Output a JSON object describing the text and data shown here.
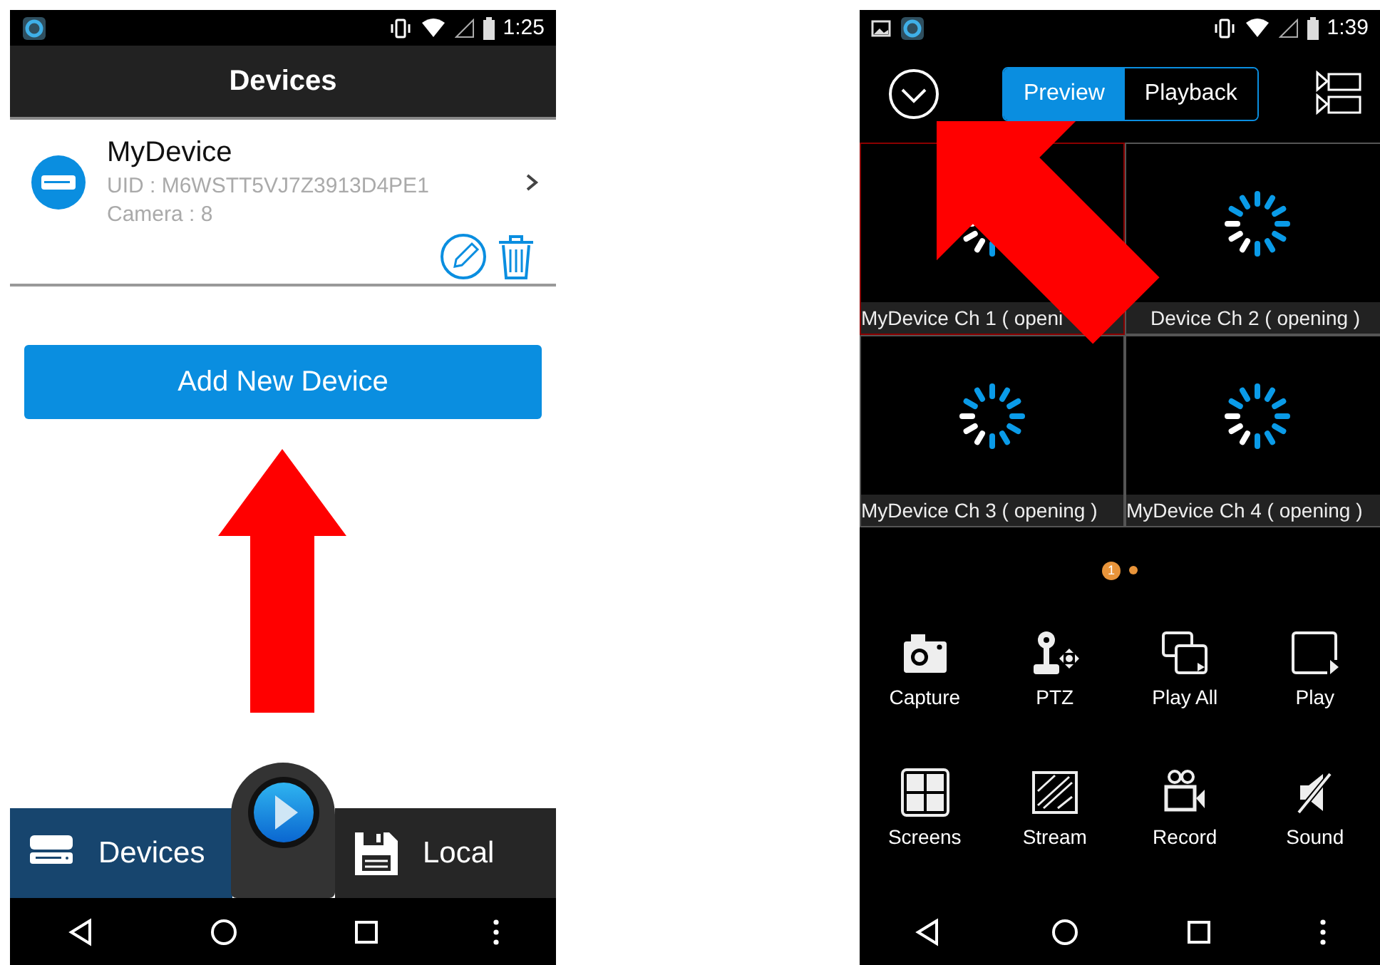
{
  "left_screen": {
    "status_bar": {
      "time": "1:25"
    },
    "title": "Devices",
    "devices": [
      {
        "name": "MyDevice",
        "uid": "UID : M6WSTT5VJ7Z3913D4PE1",
        "cameras": "Camera : 8"
      }
    ],
    "add_button": "Add New Device",
    "bottom_tabs": [
      {
        "kind": "devices",
        "label": "Devices",
        "selected": true
      },
      {
        "kind": "local",
        "label": "Local",
        "selected": false
      }
    ]
  },
  "right_screen": {
    "status_bar": {
      "time": "1:39"
    },
    "mode_tabs": [
      {
        "label": "Preview",
        "selected": true
      },
      {
        "label": "Playback",
        "selected": false
      }
    ],
    "channels": [
      {
        "label": "MyDevice Ch 1 ( openi",
        "selected": true
      },
      {
        "label": "Device Ch 2 ( opening )",
        "selected": false
      },
      {
        "label": "MyDevice Ch 3 ( opening )",
        "selected": false
      },
      {
        "label": "MyDevice Ch 4 ( opening )",
        "selected": false
      }
    ],
    "pages": [
      {
        "label": "1",
        "selected": true
      },
      {
        "selected": false
      }
    ],
    "actions": [
      {
        "kind": "capture",
        "label": "Capture"
      },
      {
        "kind": "ptz",
        "label": "PTZ"
      },
      {
        "kind": "play_all",
        "label": "Play All"
      },
      {
        "kind": "play",
        "label": "Play"
      },
      {
        "kind": "screens",
        "label": "Screens"
      },
      {
        "kind": "stream",
        "label": "Stream"
      },
      {
        "kind": "record",
        "label": "Record"
      },
      {
        "kind": "sound",
        "label": "Sound"
      }
    ]
  },
  "annotations": [
    {
      "kind": "arrow_up"
    },
    {
      "kind": "arrow_up_left"
    }
  ]
}
